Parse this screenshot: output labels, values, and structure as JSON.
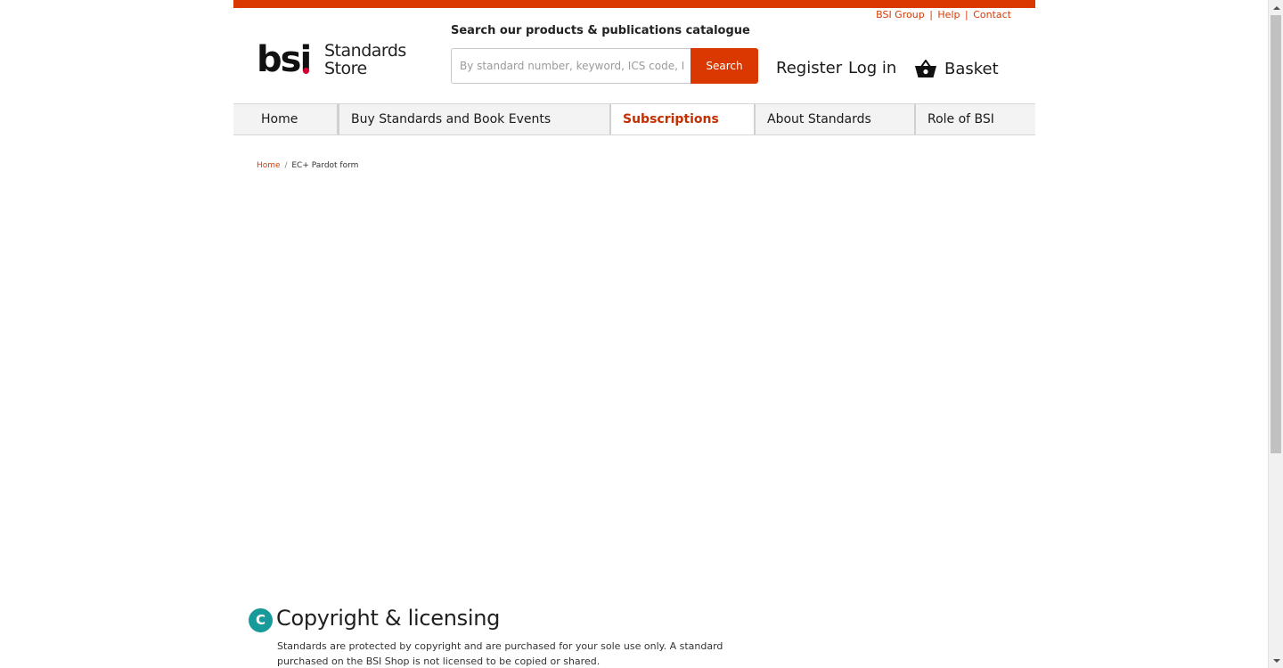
{
  "utility_links": {
    "group": "BSI Group",
    "help": "Help",
    "contact": "Contact",
    "separator": "|"
  },
  "logo": {
    "brand": "bsi",
    "store_line1": "Standards",
    "store_line2": "Store"
  },
  "search": {
    "label": "Search our products & publications catalogue",
    "placeholder": "By standard number, keyword, ICS code, IS",
    "button_label": "Search"
  },
  "account": {
    "register": "Register",
    "login": "Log in",
    "basket": "Basket"
  },
  "nav": {
    "items": [
      {
        "label": "Home",
        "active": false
      },
      {
        "label": "Buy Standards and Book Events",
        "active": false
      },
      {
        "label": "Subscriptions",
        "active": true
      },
      {
        "label": "About Standards",
        "active": false
      },
      {
        "label": "Role of BSI",
        "active": false
      }
    ]
  },
  "breadcrumb": {
    "home": "Home",
    "separator": "/",
    "current": "EC+ Pardot form"
  },
  "copyright": {
    "badge": "C",
    "title": "Copyright & licensing",
    "text": "Standards are protected by copyright and are purchased for your sole use only. A standard purchased on the BSI Shop is not licensed to be copied or shared."
  },
  "colors": {
    "brand_accent": "#d93900",
    "active_nav": "#c22f00",
    "badge_teal": "#199a9a",
    "logo_dot": "#d50032"
  },
  "icons": {
    "basket": "basket-icon",
    "scroll_up": "chevron-up-icon",
    "scroll_down": "chevron-down-icon"
  }
}
